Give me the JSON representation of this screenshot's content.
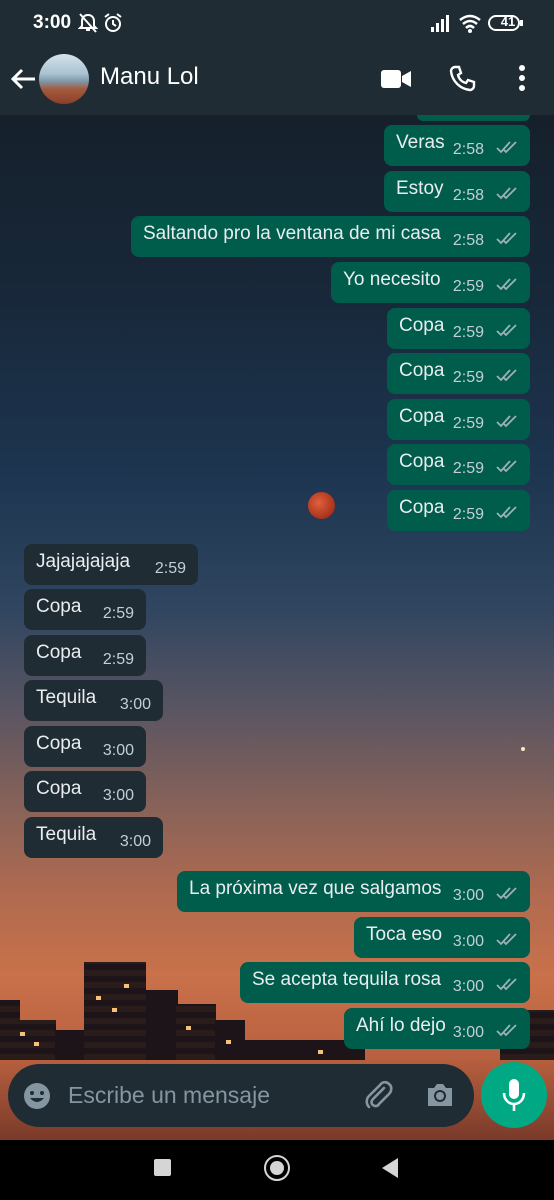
{
  "status_bar": {
    "time": "3:00",
    "battery": "41"
  },
  "header": {
    "contact_name": "Manu Lol"
  },
  "messages": [
    {
      "text": "Veras",
      "time": "2:58"
    },
    {
      "text": "Estoy",
      "time": "2:58"
    },
    {
      "text": "Saltando pro la ventana de mi casa",
      "time": "2:58"
    },
    {
      "text": "Yo necesito",
      "time": "2:59"
    },
    {
      "text": "Copa",
      "time": "2:59"
    },
    {
      "text": "Copa",
      "time": "2:59"
    },
    {
      "text": "Copa",
      "time": "2:59"
    },
    {
      "text": "Copa",
      "time": "2:59"
    },
    {
      "text": "Copa",
      "time": "2:59"
    },
    {
      "text": "Jajajajajaja",
      "time": "2:59"
    },
    {
      "text": "Copa",
      "time": "2:59"
    },
    {
      "text": "Copa",
      "time": "2:59"
    },
    {
      "text": "Tequila",
      "time": "3:00"
    },
    {
      "text": "Copa",
      "time": "3:00"
    },
    {
      "text": "Copa",
      "time": "3:00"
    },
    {
      "text": "Tequila",
      "time": "3:00"
    },
    {
      "text": "La próxima vez que salgamos",
      "time": "3:00"
    },
    {
      "text": "Toca eso",
      "time": "3:00"
    },
    {
      "text": "Se acepta tequila rosa",
      "time": "3:00"
    },
    {
      "text": "Ahí lo dejo",
      "time": "3:00"
    }
  ],
  "composer": {
    "placeholder": "Escribe un mensaje"
  },
  "colors": {
    "header": "#1f2c34",
    "outgoing_bubble": "#005c4b",
    "incoming_bubble": "#202c33",
    "accent": "#00a884",
    "read_ticks": "#9db0bb"
  },
  "icons": [
    "back-arrow-icon",
    "video-call-icon",
    "voice-call-icon",
    "more-options-icon",
    "emoji-icon",
    "attach-icon",
    "camera-icon",
    "mic-icon",
    "nav-recents-icon",
    "nav-home-icon",
    "nav-back-icon"
  ]
}
